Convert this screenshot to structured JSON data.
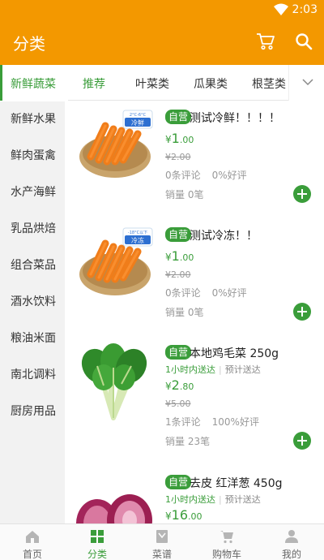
{
  "status_bar": {
    "time": "2:03"
  },
  "header": {
    "title": "分类"
  },
  "top_tabs": [
    {
      "label": "新鲜蔬菜",
      "active": true
    },
    {
      "label": "推荐",
      "active": true
    },
    {
      "label": "叶菜类",
      "active": false
    },
    {
      "label": "瓜果类",
      "active": false
    },
    {
      "label": "根茎类",
      "active": false
    }
  ],
  "sidebar": {
    "items": [
      "新鲜水果",
      "鲜肉蛋禽",
      "水产海鲜",
      "乳品烘焙",
      "组合菜品",
      "酒水饮料",
      "粮油米面",
      "南北调料",
      "厨房用品"
    ]
  },
  "products": [
    {
      "badge": "自营",
      "name": "测试冷鲜！！！！",
      "image": "carrots-in-basket",
      "image_tag": "冷鲜",
      "image_tag_top": "2°C-6°C",
      "price_symbol": "¥",
      "price_int": "1",
      "price_dec": ".00",
      "old_price": "¥2.00",
      "reviews": "0条评论",
      "rating": "0%好评",
      "sales": "销量 0笔"
    },
    {
      "badge": "自营",
      "name": "测试冷冻！！",
      "image": "carrots-in-basket",
      "image_tag": "冷冻",
      "image_tag_top": "-18°C以下",
      "price_symbol": "¥",
      "price_int": "1",
      "price_dec": ".00",
      "old_price": "¥2.00",
      "reviews": "0条评论",
      "rating": "0%好评",
      "sales": "销量 0笔"
    },
    {
      "badge": "自营",
      "name": "本地鸡毛菜 250g",
      "image": "green-leafy-vegetable",
      "delivery_fast": "1小时内送达",
      "delivery_est": "预计送达",
      "price_symbol": "¥",
      "price_int": "2",
      "price_dec": ".80",
      "old_price": "¥5.00",
      "reviews": "1条评论",
      "rating": "100%好评",
      "sales": "销量 23笔"
    },
    {
      "badge": "自营",
      "name": "去皮 红洋葱 450g",
      "image": "red-onions",
      "delivery_fast": "1小时内送达",
      "delivery_est": "预计送达",
      "price_symbol": "¥",
      "price_int": "16",
      "price_dec": ".00"
    }
  ],
  "bottom_nav": [
    {
      "label": "首页",
      "icon": "home-icon",
      "active": false
    },
    {
      "label": "分类",
      "icon": "category-grid-icon",
      "active": true
    },
    {
      "label": "菜谱",
      "icon": "recipe-icon",
      "active": false
    },
    {
      "label": "购物车",
      "icon": "cart-icon",
      "active": false
    },
    {
      "label": "我的",
      "icon": "user-icon",
      "active": false
    }
  ],
  "colors": {
    "brand_orange": "#f39800",
    "accent_green": "#3a9d3a"
  }
}
